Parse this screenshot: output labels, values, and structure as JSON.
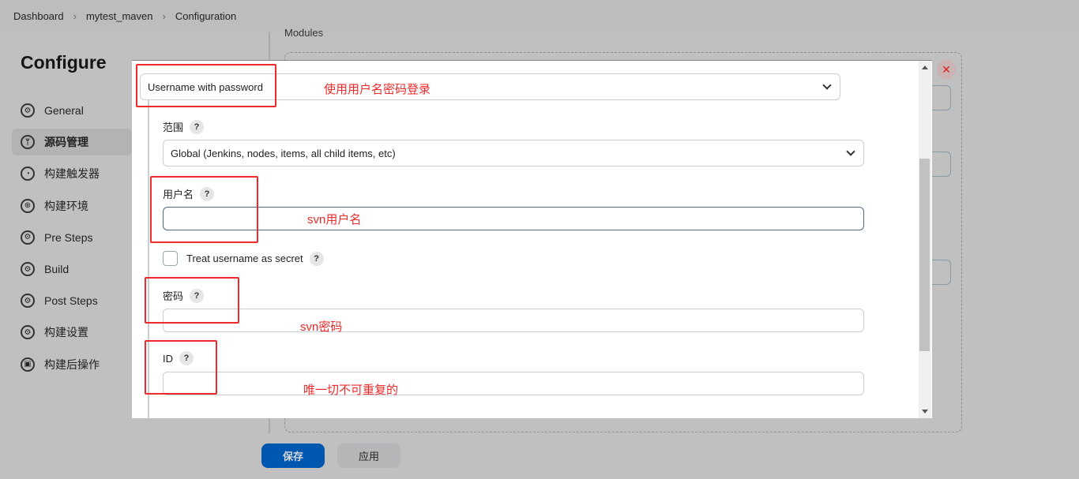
{
  "breadcrumb": [
    "Dashboard",
    "mytest_maven",
    "Configuration"
  ],
  "page_title": "Configure",
  "sidebar": {
    "items": [
      {
        "label": "General",
        "icon": "gear-icon"
      },
      {
        "label": "源码管理",
        "icon": "branch-icon",
        "active": true
      },
      {
        "label": "构建触发器",
        "icon": "clock-icon"
      },
      {
        "label": "构建环境",
        "icon": "globe-icon"
      },
      {
        "label": "Pre Steps",
        "icon": "gear-icon"
      },
      {
        "label": "Build",
        "icon": "gear-icon"
      },
      {
        "label": "Post Steps",
        "icon": "gear-icon"
      },
      {
        "label": "构建设置",
        "icon": "gear-icon"
      },
      {
        "label": "构建后操作",
        "icon": "package-icon"
      }
    ]
  },
  "main": {
    "modules_label": "Modules"
  },
  "buttons": {
    "save": "保存",
    "apply": "应用"
  },
  "modal": {
    "kind_value": "Username with password",
    "scope_label": "范围",
    "scope_value": "Global (Jenkins, nodes, items, all child items, etc)",
    "username_label": "用户名",
    "username_value": "",
    "secret_label": "Treat username as secret",
    "password_label": "密码",
    "id_label": "ID",
    "help": "?"
  },
  "annotations": {
    "kind": "使用用户名密码登录",
    "username": "svn用户名",
    "password": "svn密码",
    "id": "唯一切不可重复的"
  },
  "colors": {
    "annotation": "#ee2a2a",
    "primary": "#0057b0"
  }
}
